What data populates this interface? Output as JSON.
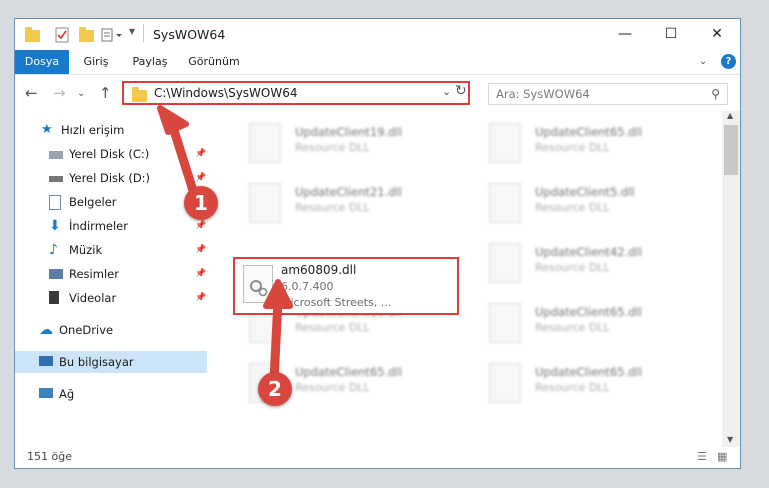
{
  "window": {
    "title": "SysWOW64",
    "controls": {
      "minimize": "—",
      "maximize": "☐",
      "close": "✕"
    }
  },
  "ribbon": {
    "tabs": [
      "Dosya",
      "Giriş",
      "Paylaş",
      "Görünüm"
    ]
  },
  "address": {
    "path": "C:\\Windows\\SysWOW64",
    "search_placeholder": "Ara: SysWOW64"
  },
  "sidebar": {
    "items": [
      {
        "label": "Hızlı erişim",
        "icon": "star-icon"
      },
      {
        "label": "Yerel Disk (C:)",
        "icon": "drive-icon",
        "pinned": true
      },
      {
        "label": "Yerel Disk (D:)",
        "icon": "drive-icon",
        "pinned": true
      },
      {
        "label": "Belgeler",
        "icon": "documents-icon",
        "pinned": true
      },
      {
        "label": "İndirmeler",
        "icon": "download-icon",
        "pinned": true
      },
      {
        "label": "Müzik",
        "icon": "music-icon",
        "pinned": true
      },
      {
        "label": "Resimler",
        "icon": "pictures-icon",
        "pinned": true
      },
      {
        "label": "Videolar",
        "icon": "videos-icon",
        "pinned": true
      },
      {
        "label": "OneDrive",
        "icon": "cloud-icon"
      },
      {
        "label": "Bu bilgisayar",
        "icon": "computer-icon",
        "selected": true
      },
      {
        "label": "Ağ",
        "icon": "network-icon"
      }
    ]
  },
  "files": {
    "tiles": [
      {
        "name": "UpdateClient19.dll",
        "type": "Resource DLL"
      },
      {
        "name": "UpdateClient65.dll",
        "type": "Resource DLL"
      },
      {
        "name": "UpdateClient21.dll",
        "type": "Resource DLL"
      },
      {
        "name": "UpdateClient5.dll",
        "type": "Resource DLL"
      },
      {
        "name": "UpdateClient42.dll",
        "type": "Resource DLL"
      },
      {
        "name": "UpdateClient19.dll",
        "type": "Resource DLL"
      },
      {
        "name": "UpdateClient65.dll",
        "type": "Resource DLL"
      },
      {
        "name": "UpdateClient65.dll",
        "type": "Resource DLL"
      },
      {
        "name": "UpdateClient65.dll",
        "type": "Resource DLL"
      }
    ],
    "highlighted": {
      "name": "am60809.dll",
      "version": "6.0.7.400",
      "company": "Microsoft Streets, ..."
    }
  },
  "status": {
    "count": "151 öğe"
  },
  "annotations": {
    "step1": "1",
    "step2": "2",
    "color": "#d9463e"
  }
}
